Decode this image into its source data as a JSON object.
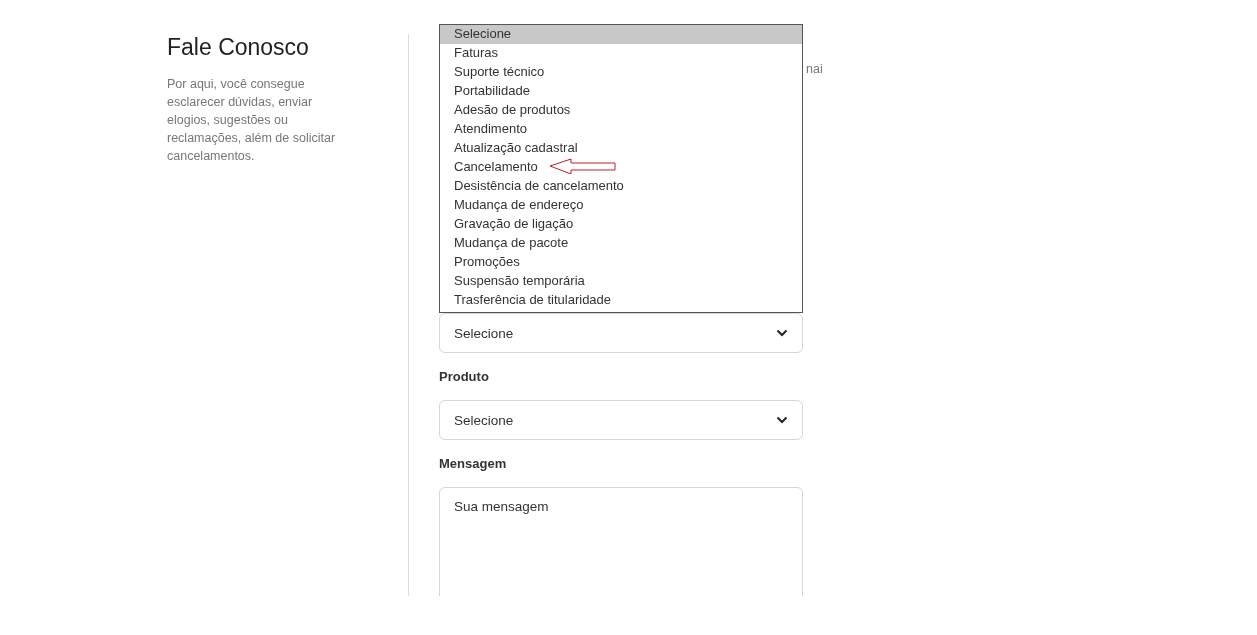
{
  "sidebar": {
    "title": "Fale Conosco",
    "description": "Por aqui, você consegue esclarecer dúvidas, enviar elogios, sugestões ou reclamações, além de solicitar cancelamentos."
  },
  "form": {
    "hidden_hint_tail": "nai",
    "subject_options": [
      {
        "label": "Selecione",
        "selected": true
      },
      {
        "label": "Faturas",
        "selected": false
      },
      {
        "label": "Suporte técnico",
        "selected": false
      },
      {
        "label": "Portabilidade",
        "selected": false
      },
      {
        "label": "Adesão de produtos",
        "selected": false
      },
      {
        "label": "Atendimento",
        "selected": false
      },
      {
        "label": "Atualização cadastral",
        "selected": false
      },
      {
        "label": "Cancelamento",
        "selected": false
      },
      {
        "label": "Desistência de cancelamento",
        "selected": false
      },
      {
        "label": "Mudança de endereço",
        "selected": false
      },
      {
        "label": "Gravação de ligação",
        "selected": false
      },
      {
        "label": "Mudança de pacote",
        "selected": false
      },
      {
        "label": "Promoções",
        "selected": false
      },
      {
        "label": "Suspensão temporária",
        "selected": false
      },
      {
        "label": "Trasferência de titularidade",
        "selected": false
      }
    ],
    "subject_select": {
      "value": "Selecione"
    },
    "product": {
      "label": "Produto",
      "value": "Selecione"
    },
    "message": {
      "label": "Mensagem",
      "placeholder": "Sua mensagem"
    }
  }
}
